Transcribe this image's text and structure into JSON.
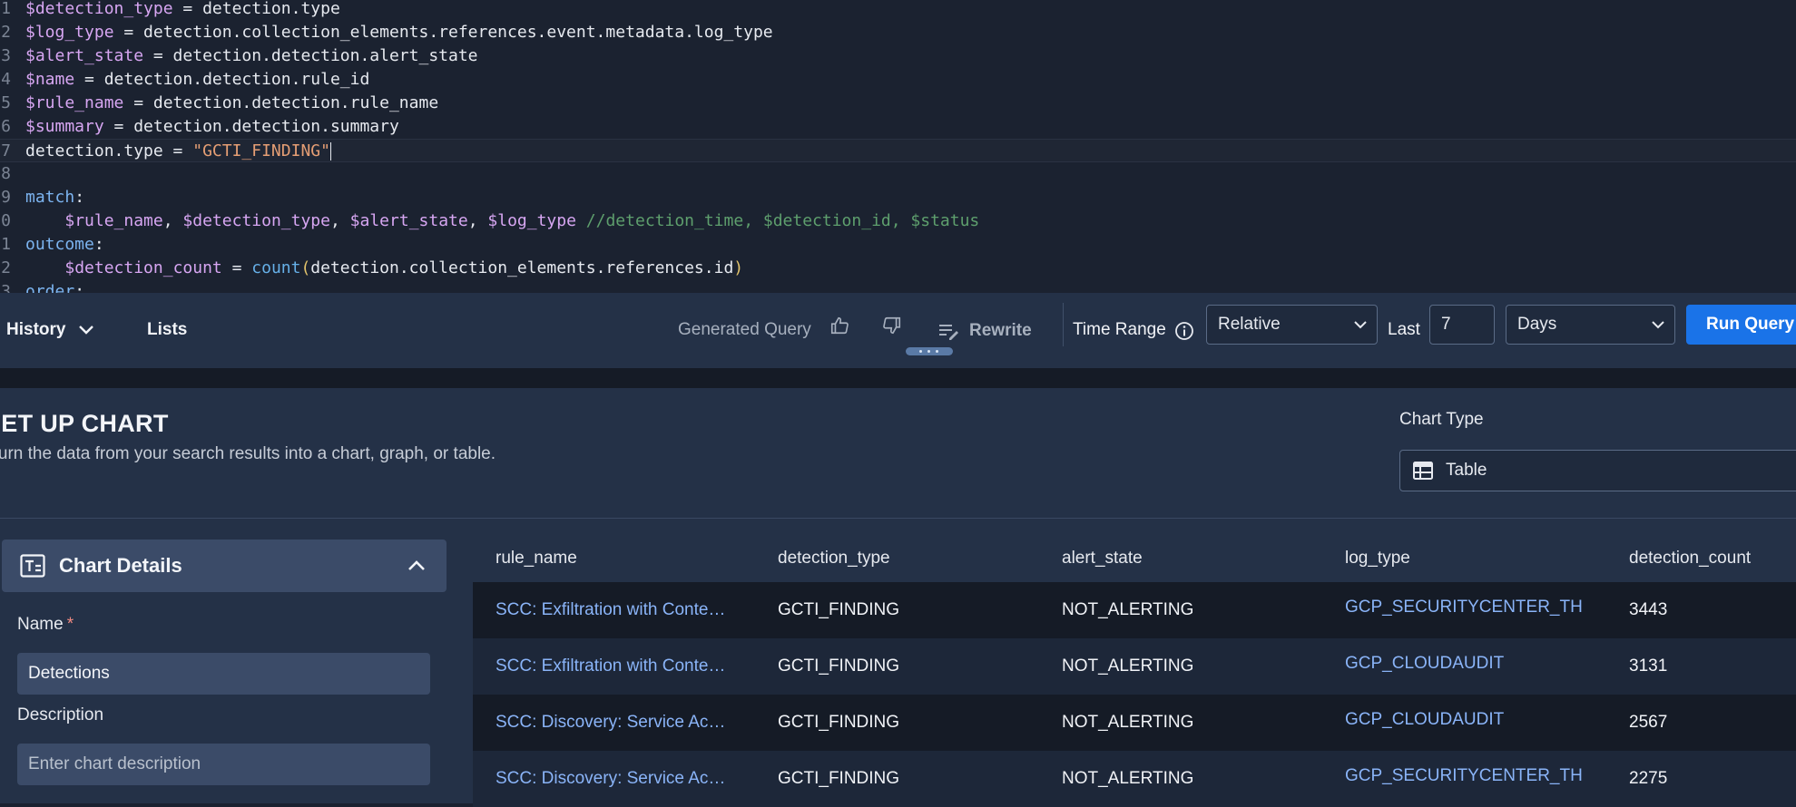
{
  "editor": {
    "lines": [
      {
        "n": "1",
        "parts": [
          [
            "v",
            "$detection_type"
          ],
          [
            "t",
            " = detection.type"
          ]
        ]
      },
      {
        "n": "2",
        "parts": [
          [
            "v",
            "$log_type"
          ],
          [
            "t",
            " = detection.collection_elements.references.event.metadata.log_type"
          ]
        ]
      },
      {
        "n": "3",
        "parts": [
          [
            "v",
            "$alert_state"
          ],
          [
            "t",
            " = detection.detection.alert_state"
          ]
        ]
      },
      {
        "n": "4",
        "parts": [
          [
            "v",
            "$name"
          ],
          [
            "t",
            " = detection.detection.rule_id"
          ]
        ]
      },
      {
        "n": "5",
        "parts": [
          [
            "v",
            "$rule_name"
          ],
          [
            "t",
            " = detection.detection.rule_name"
          ]
        ]
      },
      {
        "n": "6",
        "parts": [
          [
            "v",
            "$summary"
          ],
          [
            "t",
            " = detection.detection.summary"
          ]
        ]
      },
      {
        "n": "7",
        "parts": [
          [
            "t",
            "detection.type = "
          ],
          [
            "s",
            "\"GCTI_FINDING\""
          ]
        ],
        "active": true
      },
      {
        "n": "8",
        "parts": []
      },
      {
        "n": "9",
        "parts": [
          [
            "k",
            "match"
          ],
          [
            "t",
            ":"
          ]
        ]
      },
      {
        "n": "0",
        "parts": [
          [
            "t",
            "    "
          ],
          [
            "v",
            "$rule_name"
          ],
          [
            "t",
            ", "
          ],
          [
            "v",
            "$detection_type"
          ],
          [
            "t",
            ", "
          ],
          [
            "v",
            "$alert_state"
          ],
          [
            "t",
            ", "
          ],
          [
            "v",
            "$log_type"
          ],
          [
            "t",
            " "
          ],
          [
            "c",
            "//detection_time, $detection_id, $status"
          ]
        ]
      },
      {
        "n": "1",
        "parts": [
          [
            "k",
            "outcome"
          ],
          [
            "t",
            ":"
          ]
        ]
      },
      {
        "n": "2",
        "parts": [
          [
            "t",
            "    "
          ],
          [
            "v",
            "$detection_count"
          ],
          [
            "t",
            " = "
          ],
          [
            "f",
            "count"
          ],
          [
            "p",
            "("
          ],
          [
            "t",
            "detection.collection_elements.references.id"
          ],
          [
            "p",
            ")"
          ]
        ]
      },
      {
        "n": "3",
        "parts": [
          [
            "k",
            "order"
          ],
          [
            "t",
            ":"
          ]
        ]
      }
    ]
  },
  "toolbar": {
    "history": "History",
    "lists": "Lists",
    "generated_query": "Generated Query",
    "rewrite": "Rewrite",
    "time_range": "Time Range",
    "range_mode": "Relative",
    "last_label": "Last",
    "last_value": "7",
    "unit": "Days",
    "run_query": "Run Query"
  },
  "setup": {
    "title": "SET UP CHART",
    "subtitle": "Turn the data from your search results into a chart, graph, or table.",
    "chart_type_label": "Chart Type",
    "chart_type_value": "Table"
  },
  "details": {
    "title": "Chart Details",
    "name_label": "Name",
    "required_mark": "*",
    "name_value": "Detections",
    "description_label": "Description",
    "description_placeholder": "Enter chart description"
  },
  "table": {
    "columns": [
      "rule_name",
      "detection_type",
      "alert_state",
      "log_type",
      "detection_count"
    ],
    "rows": [
      [
        "SCC: Exfiltration with Content Transfer",
        "GCTI_FINDING",
        "NOT_ALERTING",
        "GCP_SECURITYCENTER_THREAT",
        "3443"
      ],
      [
        "SCC: Exfiltration with Content Transfer",
        "GCTI_FINDING",
        "NOT_ALERTING",
        "GCP_CLOUDAUDIT",
        "3131"
      ],
      [
        "SCC: Discovery: Service Account Self-Investigation",
        "GCTI_FINDING",
        "NOT_ALERTING",
        "GCP_CLOUDAUDIT",
        "2567"
      ],
      [
        "SCC: Discovery: Service Account Self-Investigation",
        "GCTI_FINDING",
        "NOT_ALERTING",
        "GCP_SECURITYCENTER_THREAT",
        "2275"
      ]
    ]
  }
}
